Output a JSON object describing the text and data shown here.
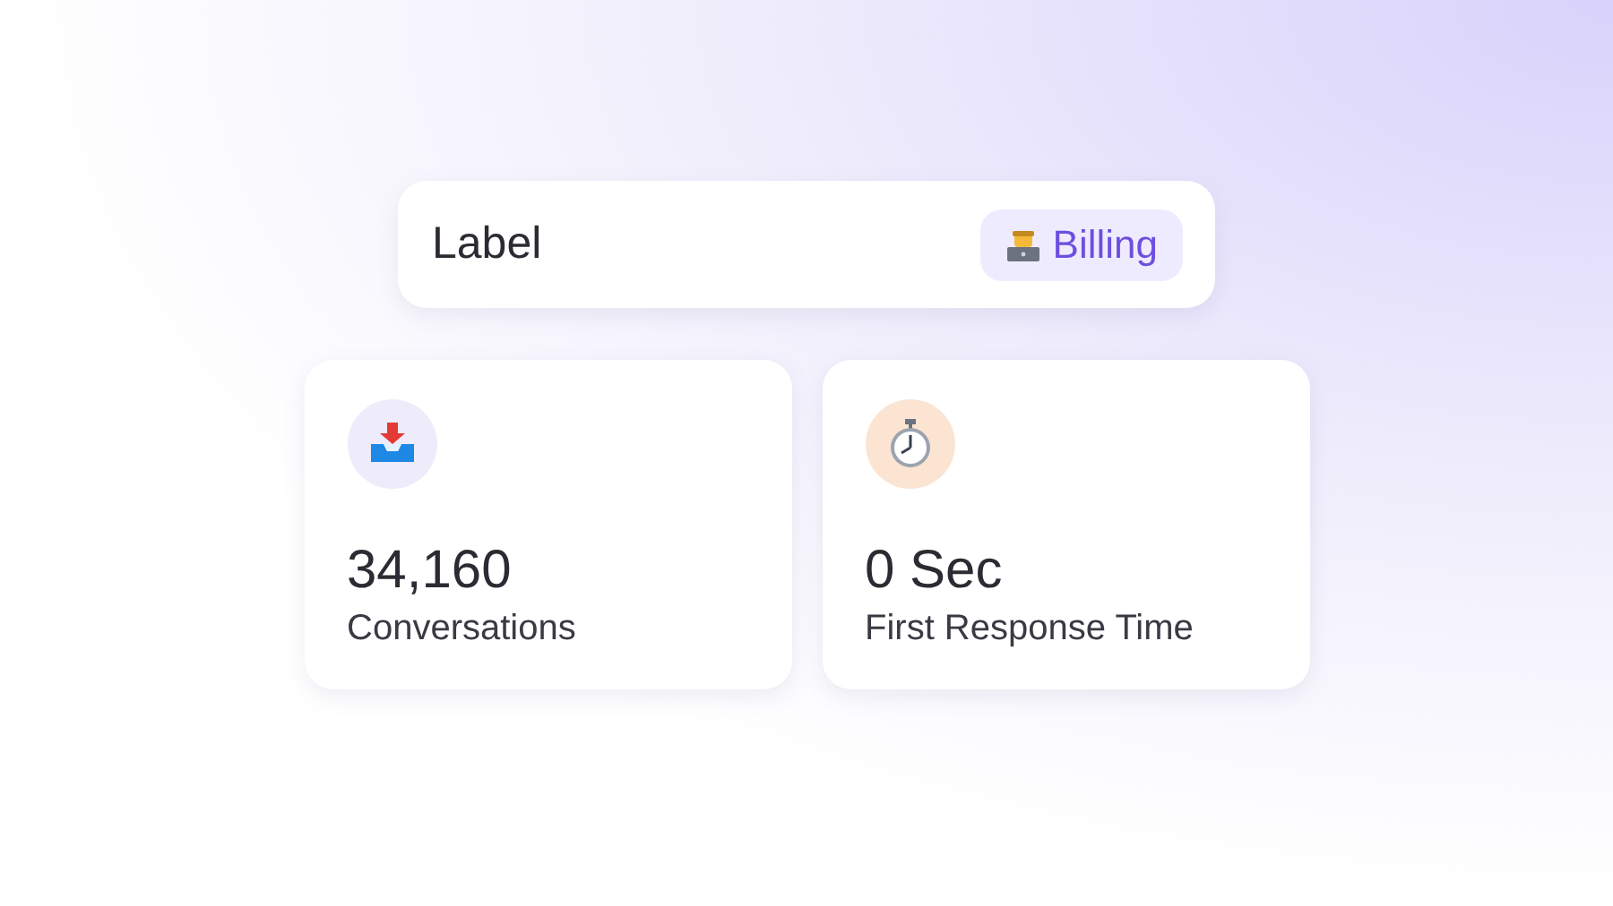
{
  "label_card": {
    "title": "Label",
    "tag": "Billing"
  },
  "stats": [
    {
      "value": "34,160",
      "label": "Conversations"
    },
    {
      "value": "0 Sec",
      "label": "First Response Time"
    }
  ]
}
